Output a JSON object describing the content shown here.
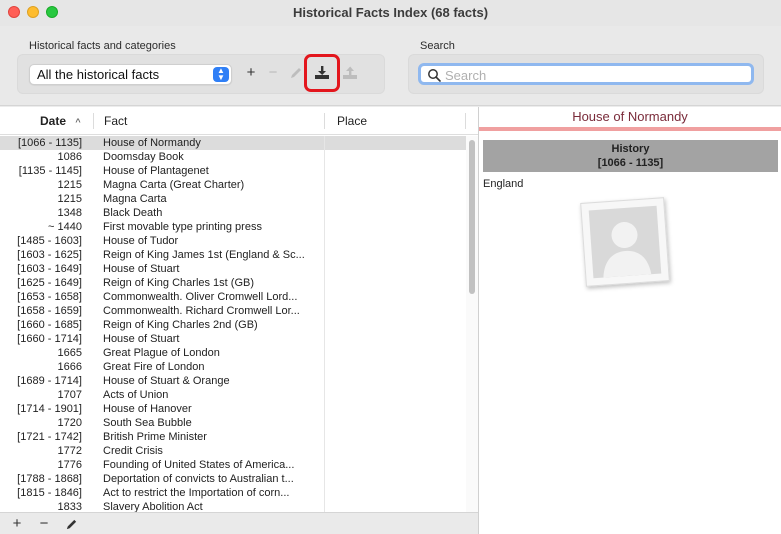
{
  "window": {
    "title": "Historical Facts Index (68 facts)"
  },
  "toolbar": {
    "facts_group_label": "Historical facts and categories",
    "category_selected": "All the historical facts",
    "add_button": "+",
    "remove_button": "−",
    "search_group_label": "Search",
    "search_placeholder": "Search"
  },
  "table": {
    "headers": {
      "date": "Date",
      "fact": "Fact",
      "place": "Place"
    },
    "rows": [
      {
        "date": "[1066 - 1135]",
        "fact": "House of Normandy",
        "place": ""
      },
      {
        "date": "1086",
        "fact": "Doomsday Book",
        "place": ""
      },
      {
        "date": "[1135 - 1145]",
        "fact": "House of Plantagenet",
        "place": ""
      },
      {
        "date": "1215",
        "fact": "Magna Carta (Great Charter)",
        "place": ""
      },
      {
        "date": "1215",
        "fact": "Magna Carta",
        "place": ""
      },
      {
        "date": "1348",
        "fact": "Black Death",
        "place": ""
      },
      {
        "date": "~ 1440",
        "fact": "First movable type printing press",
        "place": ""
      },
      {
        "date": "[1485 - 1603]",
        "fact": "House of Tudor",
        "place": ""
      },
      {
        "date": "[1603 - 1625]",
        "fact": "Reign of King James 1st (England & Sc...",
        "place": ""
      },
      {
        "date": "[1603 - 1649]",
        "fact": "House of Stuart",
        "place": ""
      },
      {
        "date": "[1625 - 1649]",
        "fact": "Reign of King Charles 1st (GB)",
        "place": ""
      },
      {
        "date": "[1653 - 1658]",
        "fact": "Commonwealth. Oliver Cromwell Lord...",
        "place": ""
      },
      {
        "date": "[1658 - 1659]",
        "fact": "Commonwealth. Richard Cromwell Lor...",
        "place": ""
      },
      {
        "date": "[1660 - 1685]",
        "fact": "Reign of King Charles 2nd (GB)",
        "place": ""
      },
      {
        "date": "[1660 - 1714]",
        "fact": "House of Stuart",
        "place": ""
      },
      {
        "date": "1665",
        "fact": "Great Plague of London",
        "place": ""
      },
      {
        "date": "1666",
        "fact": "Great Fire of London",
        "place": ""
      },
      {
        "date": "[1689 - 1714]",
        "fact": "House of Stuart & Orange",
        "place": ""
      },
      {
        "date": "1707",
        "fact": "Acts of Union",
        "place": ""
      },
      {
        "date": "[1714 - 1901]",
        "fact": "House of Hanover",
        "place": ""
      },
      {
        "date": "1720",
        "fact": "South Sea Bubble",
        "place": ""
      },
      {
        "date": "[1721 - 1742]",
        "fact": "British Prime Minister",
        "place": ""
      },
      {
        "date": "1772",
        "fact": "Credit Crisis",
        "place": ""
      },
      {
        "date": "1776",
        "fact": "Founding of United States of America...",
        "place": ""
      },
      {
        "date": "[1788 - 1868]",
        "fact": "Deportation of convicts to Australian t...",
        "place": ""
      },
      {
        "date": "[1815 - 1846]",
        "fact": "Act to restrict the Importation of corn...",
        "place": ""
      },
      {
        "date": "1833",
        "fact": "Slavery Abolition Act",
        "place": ""
      }
    ]
  },
  "bottom_bar": {
    "add": "+",
    "remove": "−"
  },
  "detail": {
    "title": "House of Normandy",
    "category": "History",
    "range": "[1066 - 1135]",
    "place": "England"
  },
  "colors": {
    "detail_title": "#7a2b3a",
    "detail_rule": "#f0a0a0",
    "highlight": "#e3161d",
    "accent": "#2f7ff6"
  },
  "icons": {
    "search": "magnifier-icon",
    "edit": "pencil-icon",
    "import": "download-tray-icon",
    "export": "upload-tray-icon",
    "popup": "chevron-updown-icon",
    "photo": "person-placeholder-icon"
  }
}
